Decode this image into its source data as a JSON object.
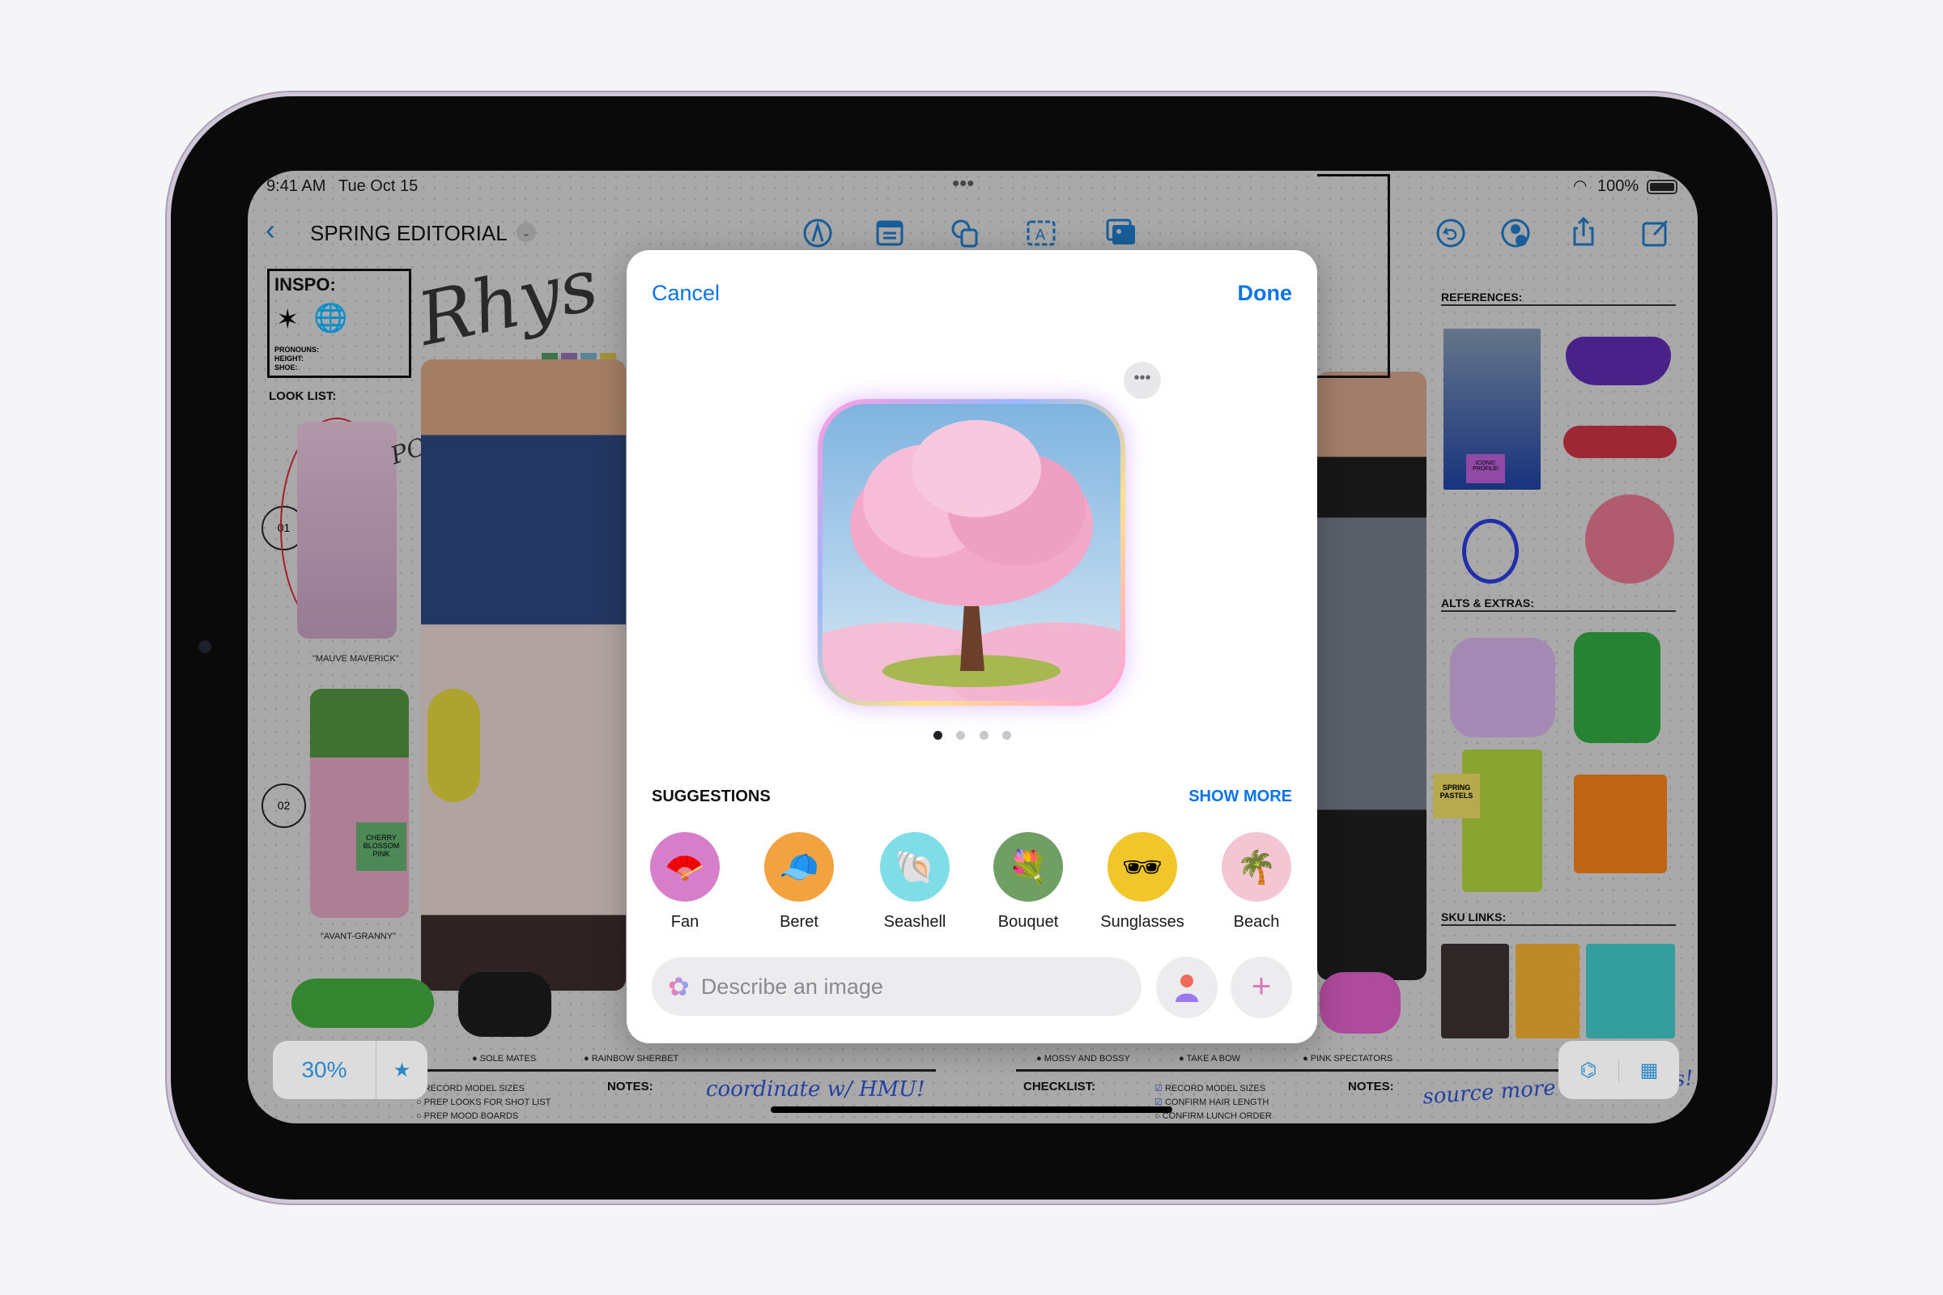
{
  "status": {
    "time": "9:41 AM",
    "date": "Tue Oct 15",
    "battery": "100%"
  },
  "toolbar": {
    "title": "SPRING EDITORIAL",
    "icons": [
      "back-chevron",
      "pen-circle",
      "text-box",
      "shapes",
      "text-format",
      "media"
    ],
    "right_icons": [
      "undo",
      "collaborate",
      "share",
      "compose"
    ]
  },
  "board": {
    "inspo": "INSPO:",
    "pronouns": "PRONOUNS:",
    "height": "HEIGHT:",
    "shoe": "SHOE:",
    "signature": "Rhys",
    "look_list": "LOOK LIST:",
    "look1": "01",
    "look2": "02",
    "look1_name": "\"MAUVE MAVERICK\"",
    "look2_name": "\"AVANT-GRANNY\"",
    "power": "POWER in pink",
    "sticky1": "CHERRY BLOSSOM PINK",
    "references": "REFERENCES:",
    "iconic": "ICONIC PROFILE!",
    "alts": "ALTS & EXTRAS:",
    "pastels": "SPRING PASTELS",
    "sku": "SKU LINKS:",
    "bullets": [
      "SOLE MATES",
      "RAINBOW SHERBET",
      "MOSSY AND BOSSY",
      "TAKE A BOW",
      "PINK SPECTATORS"
    ],
    "left_check": [
      "RECORD MODEL SIZES",
      "PREP LOOKS FOR SHOT LIST",
      "PREP MOOD BOARDS"
    ],
    "notes1_label": "NOTES:",
    "notes1": "coordinate w/ HMU!",
    "checklist_label": "CHECKLIST:",
    "right_check": [
      "RECORD MODEL SIZES",
      "CONFIRM HAIR LENGTH",
      "CONFIRM LUNCH ORDER"
    ],
    "notes2_label": "NOTES:",
    "notes2": "source more accessories!",
    "zoom": "30%"
  },
  "modal": {
    "cancel": "Cancel",
    "done": "Done",
    "image_page": 1,
    "image_pages": 4,
    "suggestions_title": "SUGGESTIONS",
    "show_more": "SHOW MORE",
    "suggestions": [
      {
        "label": "Fan",
        "glyph": "🪭",
        "color": "#d77ecb"
      },
      {
        "label": "Beret",
        "glyph": "🧢",
        "color": "#f2a23e"
      },
      {
        "label": "Seashell",
        "glyph": "🐚",
        "color": "#7fdde8"
      },
      {
        "label": "Bouquet",
        "glyph": "💐",
        "color": "#6f9f62"
      },
      {
        "label": "Sunglasses",
        "glyph": "🕶",
        "color": "#f0c62b"
      },
      {
        "label": "Beach",
        "glyph": "🌴",
        "color": "#f4c6d3"
      }
    ],
    "input_placeholder": "Describe an image"
  },
  "colors": {
    "accent": "#0a74e8",
    "toolbar": "#1e73be"
  }
}
